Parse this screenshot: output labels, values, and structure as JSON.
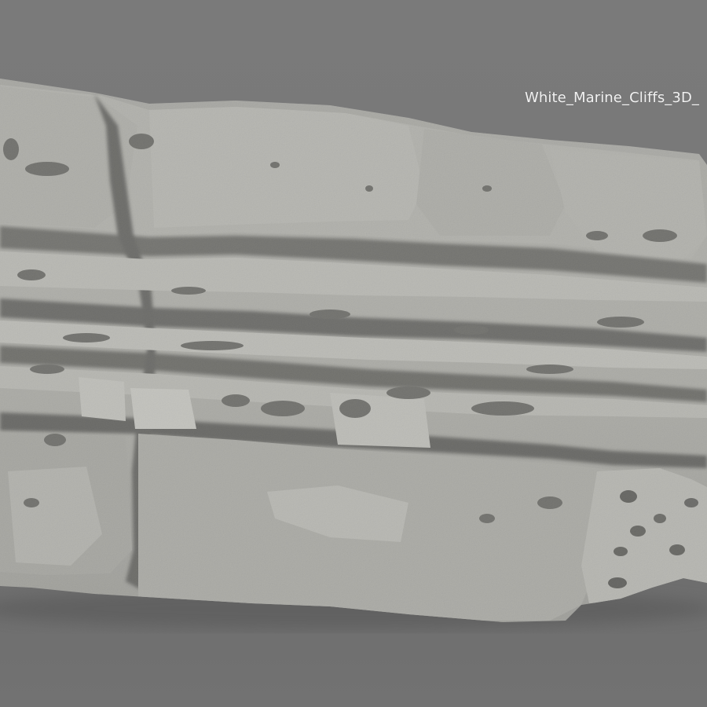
{
  "scene": {
    "caption": "White_Marine_Cliffs_3D_",
    "subject": "rock-cliff-scan",
    "colors": {
      "background": "#777777",
      "rock_light": "#c9c9c4",
      "rock_mid": "#a7a7a2",
      "rock_shadow": "#4a4a48",
      "caption_text": "#f2f2f2"
    }
  }
}
